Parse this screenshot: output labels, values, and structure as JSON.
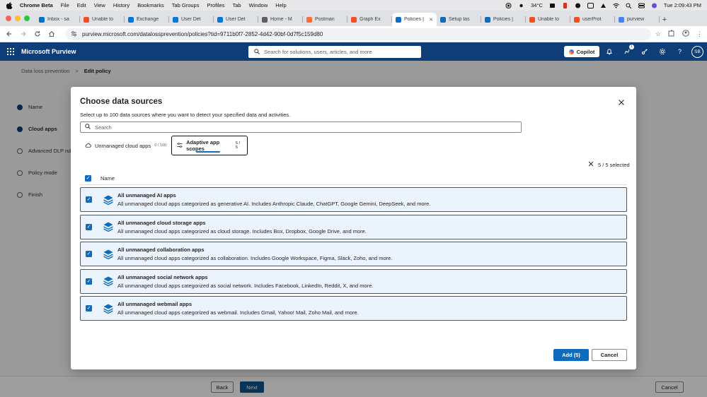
{
  "menubar": {
    "app_name": "Chrome Beta",
    "items": [
      "File",
      "Edit",
      "View",
      "History",
      "Bookmarks",
      "Tab Groups",
      "Profiles",
      "Tab",
      "Window",
      "Help"
    ],
    "temperature": "34°C",
    "clock": "Tue 2:09:43 PM"
  },
  "tabs": [
    {
      "label": "Inbox - sa",
      "color": "#0072c6"
    },
    {
      "label": "Unable to",
      "color": "#f25022"
    },
    {
      "label": "Exchange",
      "color": "#0078d4"
    },
    {
      "label": "User Det",
      "color": "#0078d4"
    },
    {
      "label": "User Det",
      "color": "#0078d4"
    },
    {
      "label": "Home - M",
      "color": "#5e5e5e"
    },
    {
      "label": "Postman",
      "color": "#ff6c37"
    },
    {
      "label": "Graph Ex",
      "color": "#f25022"
    },
    {
      "label": "Policies |",
      "color": "#0f6cbd",
      "active": true
    },
    {
      "label": "Setup tas",
      "color": "#0f6cbd"
    },
    {
      "label": "Policies |",
      "color": "#0f6cbd"
    },
    {
      "label": "Unable to",
      "color": "#f25022"
    },
    {
      "label": "userProt",
      "color": "#f25022"
    },
    {
      "label": "purview",
      "color": "#4285f4"
    }
  ],
  "address_bar": {
    "url": "purview.microsoft.com/datalossprevention/policies?tid=9711b0f7-2852-4d42-90bf-0d7f5c159d80"
  },
  "header": {
    "brand": "Microsoft Purview",
    "search_placeholder": "Search for solutions, users, articles, and more",
    "copilot_label": "Copilot",
    "notification_count": "1",
    "avatar_initials": "SB"
  },
  "breadcrumb": {
    "parent": "Data loss prevention",
    "current": "Edit policy"
  },
  "wizard_steps": [
    {
      "label": "Name",
      "state": "done"
    },
    {
      "label": "Cloud apps",
      "state": "current"
    },
    {
      "label": "Advanced DLP rule",
      "state": "pending"
    },
    {
      "label": "Policy mode",
      "state": "pending"
    },
    {
      "label": "Finish",
      "state": "pending"
    }
  ],
  "footer": {
    "back": "Back",
    "next": "Next",
    "cancel": "Cancel"
  },
  "modal": {
    "title": "Choose data sources",
    "subtitle": "Select up to 100 data sources where you want to detect your specified data and activities.",
    "search_placeholder": "Search",
    "tabs": [
      {
        "label": "Unmanaged cloud apps",
        "count": "0 / 100",
        "active": false
      },
      {
        "label": "Adaptive app scopes",
        "count": "5 / 5",
        "active": true
      }
    ],
    "selected_text": "5 / 5 selected",
    "column_name": "Name",
    "rows": [
      {
        "title": "All unmanaged AI apps",
        "desc": "All unmanaged cloud apps categorized as generative AI. Includes Anthropic Claude, ChatGPT, Google Gemini, DeepSeek, and more.",
        "checked": true
      },
      {
        "title": "All unmanaged cloud storage apps",
        "desc": "All unmanaged cloud apps categorized as cloud storage. Includes Box, Dropbox, Google Drive, and more.",
        "checked": true
      },
      {
        "title": "All unmanaged collaboration apps",
        "desc": "All unmanaged cloud apps categorized as collaboration. Includes Google Workspace, Figma, Slack, Zoho, and more.",
        "checked": true
      },
      {
        "title": "All unmanaged social network apps",
        "desc": "All unmanaged cloud apps categorized as social network. Includes Facebook, LinkedIn, Reddit, X, and more.",
        "checked": true
      },
      {
        "title": "All unmanaged webmail apps",
        "desc": "All unmanaged cloud apps categorized as webmail. Includes Gmail, Yahoo! Mail, Zoho Mail, and more.",
        "checked": true
      }
    ],
    "add_label": "Add (5)",
    "cancel_label": "Cancel"
  },
  "colors": {
    "header_bg": "#0f3d78",
    "primary": "#0f6cbd",
    "row_bg": "#ebf3fc"
  }
}
